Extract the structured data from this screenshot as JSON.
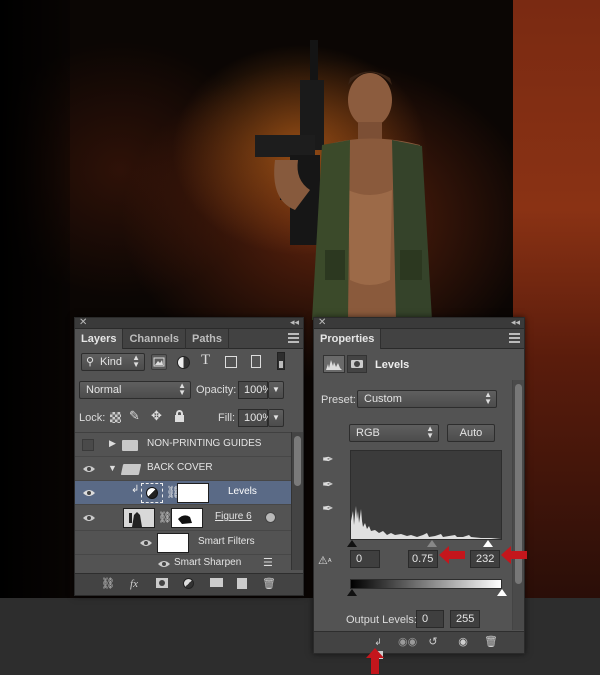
{
  "layers_panel": {
    "tabs": [
      "Layers",
      "Channels",
      "Paths"
    ],
    "filter": {
      "label": "Kind"
    },
    "blend_mode": "Normal",
    "opacity": {
      "label": "Opacity:",
      "value": "100%"
    },
    "lock": {
      "label": "Lock:"
    },
    "fill": {
      "label": "Fill:",
      "value": "100%"
    },
    "layers": [
      {
        "name": "NON-PRINTING GUIDES",
        "type": "group",
        "visible": false
      },
      {
        "name": "BACK COVER",
        "type": "group",
        "visible": true
      },
      {
        "name": "Levels",
        "type": "adjustment",
        "visible": true,
        "selected": true
      },
      {
        "name": "Figure 6",
        "type": "smart-object",
        "visible": true
      },
      {
        "name": "Smart Filters",
        "type": "smart-filters",
        "visible": true
      },
      {
        "name": "Smart Sharpen",
        "type": "filter",
        "visible": true
      }
    ]
  },
  "properties_panel": {
    "tab": "Properties",
    "adjustment_title": "Levels",
    "preset": {
      "label": "Preset:",
      "value": "Custom"
    },
    "channel": "RGB",
    "auto_label": "Auto",
    "input_levels": {
      "black": "0",
      "gamma": "0.75",
      "white": "232"
    },
    "output_levels": {
      "label": "Output Levels:",
      "black": "0",
      "white": "255"
    }
  },
  "colors": {
    "panel": "#535353",
    "selected_row": "#5a6a86",
    "arrow": "#c4161c"
  }
}
